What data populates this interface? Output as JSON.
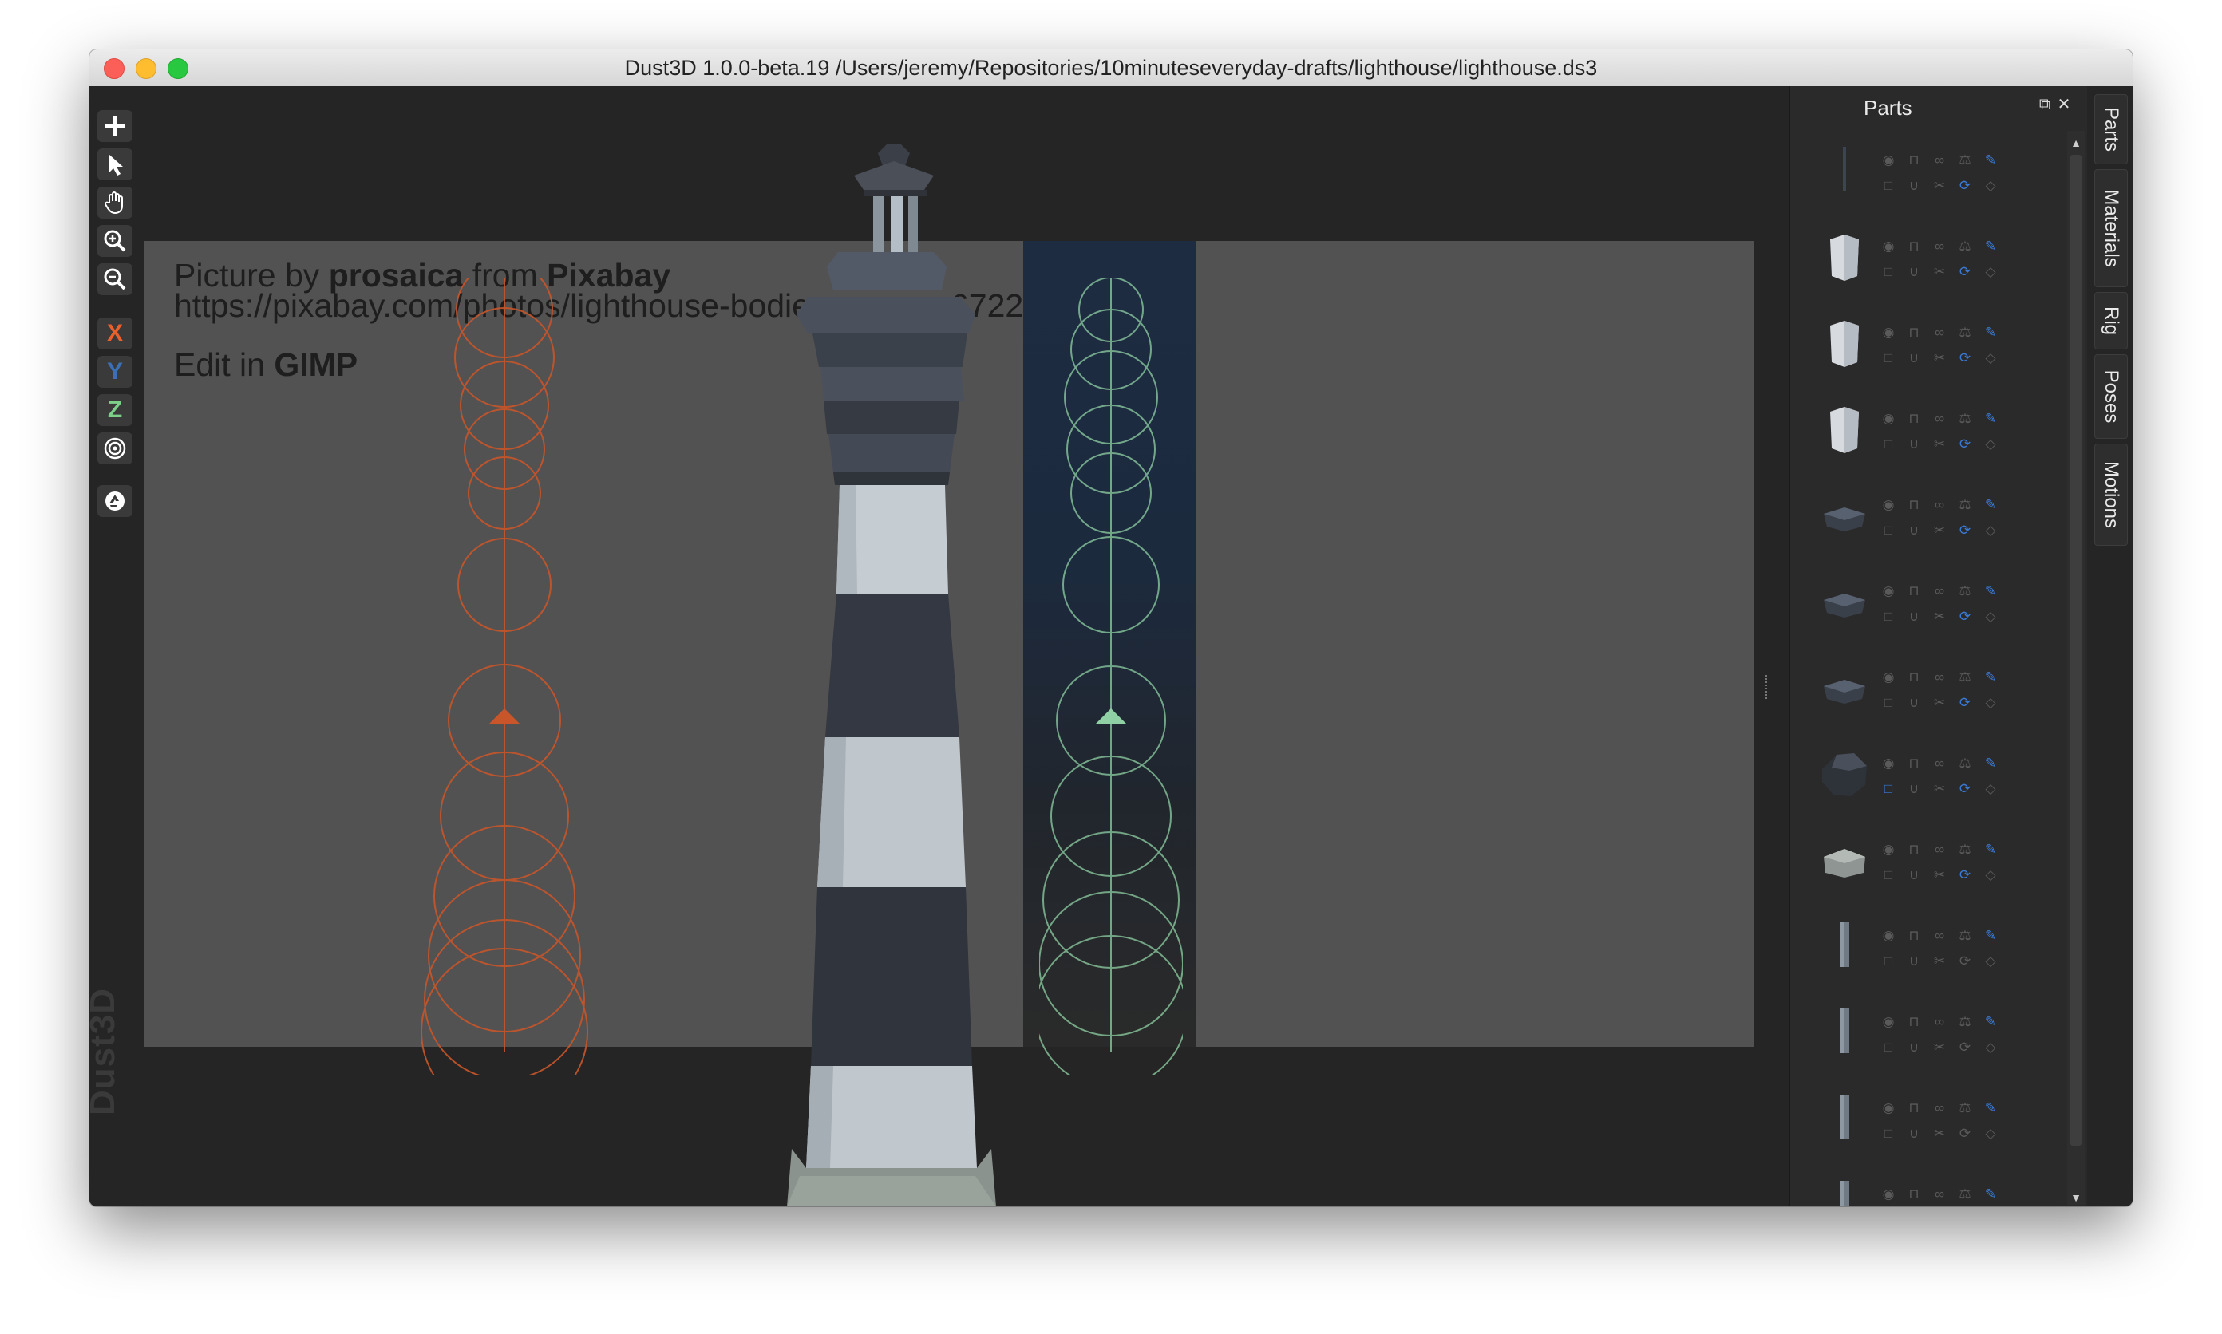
{
  "window": {
    "title": "Dust3D 1.0.0-beta.19 /Users/jeremy/Repositories/10minuteseveryday-drafts/lighthouse/lighthouse.ds3"
  },
  "toolbar": {
    "icons": [
      "add-icon",
      "select-arrow-icon",
      "hand-pan-icon",
      "zoom-in-icon",
      "zoom-out-icon",
      "axis-x",
      "axis-y",
      "axis-z",
      "radial-icon",
      "recycle-icon"
    ],
    "axis_x": "X",
    "axis_y": "Y",
    "axis_z": "Z",
    "axis_colors": {
      "x": "#e8602c",
      "y": "#3c6fb5",
      "z": "#7dcf8a"
    }
  },
  "watermark": "Dust3D",
  "canvas": {
    "credit_line1_prefix": "Picture by ",
    "credit_line1_author": "prosaica",
    "credit_line1_middle": " from ",
    "credit_line1_site": "Pixabay",
    "credit_line2": "https://pixabay.com/photos/lighthouse-bodie",
    "credit_line2_tail": "6722",
    "credit_line3_prefix": "Edit in ",
    "credit_line3_app": "GIMP",
    "side_view_color": "#c8562a",
    "front_view_color": "#8fd1a4"
  },
  "parts_panel": {
    "title": "Parts",
    "float_icon": "float-window-icon",
    "close_icon": "close-icon",
    "accent": "#3b7bd8",
    "parts": [
      {
        "shape": "thin-line",
        "selected": false
      },
      {
        "shape": "light-block",
        "selected": false
      },
      {
        "shape": "light-block",
        "selected": false
      },
      {
        "shape": "light-block",
        "selected": false
      },
      {
        "shape": "dark-slab",
        "selected": false
      },
      {
        "shape": "dark-slab",
        "selected": false
      },
      {
        "shape": "dark-slab",
        "selected": false
      },
      {
        "shape": "dark-dome",
        "selected": true
      },
      {
        "shape": "grey-slab",
        "selected": false
      },
      {
        "shape": "pillar",
        "selected": false
      },
      {
        "shape": "pillar",
        "selected": false
      },
      {
        "shape": "pillar",
        "selected": false
      },
      {
        "shape": "pillar",
        "selected": false
      }
    ]
  },
  "side_tabs": [
    "Parts",
    "Materials",
    "Rig",
    "Poses",
    "Motions"
  ]
}
